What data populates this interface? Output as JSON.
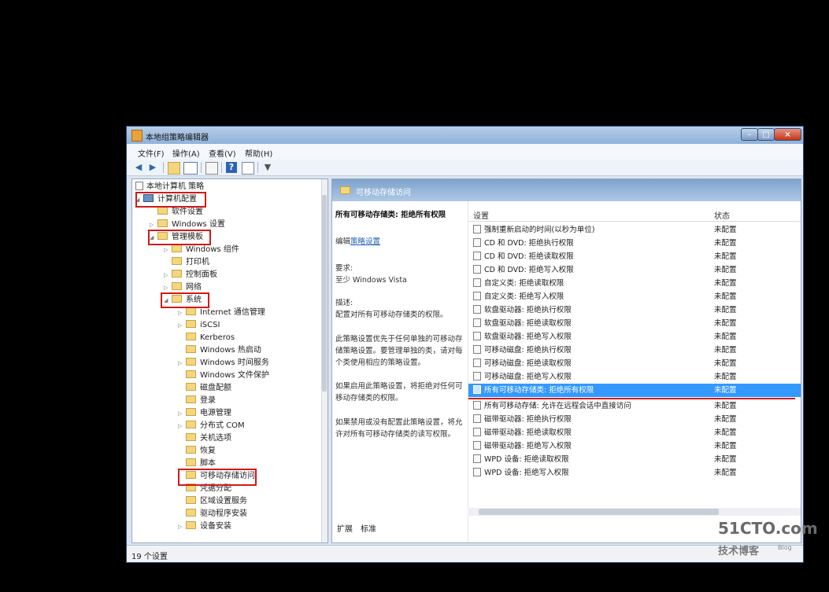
{
  "window": {
    "title": "本地组策略编辑器"
  },
  "menu": [
    "文件(F)",
    "操作(A)",
    "查看(V)",
    "帮助(H)"
  ],
  "toolbar_icons": [
    "back-arrow-icon",
    "forward-arrow-icon",
    "folder-up-icon",
    "show-hide-tree-icon",
    "export-icon",
    "help-icon",
    "properties-icon",
    "filter-icon"
  ],
  "tree": {
    "root": "本地计算机 策略",
    "computer_config": "计算机配置",
    "software_settings": "软件设置",
    "windows_settings": "Windows 设置",
    "admin_templates": "管理模板",
    "windows_components": "Windows 组件",
    "printers": "打印机",
    "control_panel": "控制面板",
    "network": "网络",
    "system": "系统",
    "system_children": [
      "Internet 通信管理",
      "iSCSI",
      "Kerberos",
      "Windows 热启动",
      "Windows 时间服务",
      "Windows 文件保护",
      "磁盘配额",
      "登录",
      "电源管理",
      "分布式 COM",
      "关机选项",
      "恢复",
      "脚本",
      "可移动存储访问",
      "凭据分配",
      "区域设置服务",
      "驱动程序安装",
      "设备安装"
    ]
  },
  "detail": {
    "header": "可移动存储访问",
    "selected_title": "所有可移动存储类: 拒绝所有权限",
    "edit_prefix": "编辑",
    "edit_link": "策略设置",
    "requirements_label": "要求:",
    "requirements_value": "至少 Windows Vista",
    "description_label": "描述:",
    "p1": "配置对所有可移动存储类的权限。",
    "p2": "此策略设置优先于任何单独的可移动存储策略设置。要管理单独的类，请对每个类使用相应的策略设置。",
    "p3": "如果启用此策略设置，将拒绝对任何可移动存储类的权限。",
    "p4": "如果禁用或没有配置此策略设置，将允许对所有可移动存储类的读写权限。"
  },
  "list": {
    "col_setting": "设置",
    "col_state": "状态",
    "rows": [
      {
        "name": "强制重新启动的时间(以秒为单位)",
        "state": "未配置"
      },
      {
        "name": "CD 和 DVD: 拒绝执行权限",
        "state": "未配置"
      },
      {
        "name": "CD 和 DVD: 拒绝读取权限",
        "state": "未配置"
      },
      {
        "name": "CD 和 DVD: 拒绝写入权限",
        "state": "未配置"
      },
      {
        "name": "自定义类: 拒绝读取权限",
        "state": "未配置"
      },
      {
        "name": "自定义类: 拒绝写入权限",
        "state": "未配置"
      },
      {
        "name": "软盘驱动器: 拒绝执行权限",
        "state": "未配置"
      },
      {
        "name": "软盘驱动器: 拒绝读取权限",
        "state": "未配置"
      },
      {
        "name": "软盘驱动器: 拒绝写入权限",
        "state": "未配置"
      },
      {
        "name": "可移动磁盘: 拒绝执行权限",
        "state": "未配置"
      },
      {
        "name": "可移动磁盘: 拒绝读取权限",
        "state": "未配置"
      },
      {
        "name": "可移动磁盘: 拒绝写入权限",
        "state": "未配置"
      },
      {
        "name": "所有可移动存储类: 拒绝所有权限",
        "state": "未配置"
      },
      {
        "name": "所有可移动存储: 允许在远程会话中直接访问",
        "state": "未配置"
      },
      {
        "name": "磁带驱动器: 拒绝执行权限",
        "state": "未配置"
      },
      {
        "name": "磁带驱动器: 拒绝读取权限",
        "state": "未配置"
      },
      {
        "name": "磁带驱动器: 拒绝写入权限",
        "state": "未配置"
      },
      {
        "name": "WPD 设备: 拒绝读取权限",
        "state": "未配置"
      },
      {
        "name": "WPD 设备: 拒绝写入权限",
        "state": "未配置"
      }
    ]
  },
  "tabs": [
    "扩展",
    "标准"
  ],
  "status": "19 个设置",
  "watermark": {
    "site": "51CTO.com",
    "sub": "技术博客",
    "blog": "Blog"
  },
  "colors": {
    "selection": "#3399ff",
    "highlight_box": "#d21a1a",
    "header": "#7ea3cd"
  }
}
